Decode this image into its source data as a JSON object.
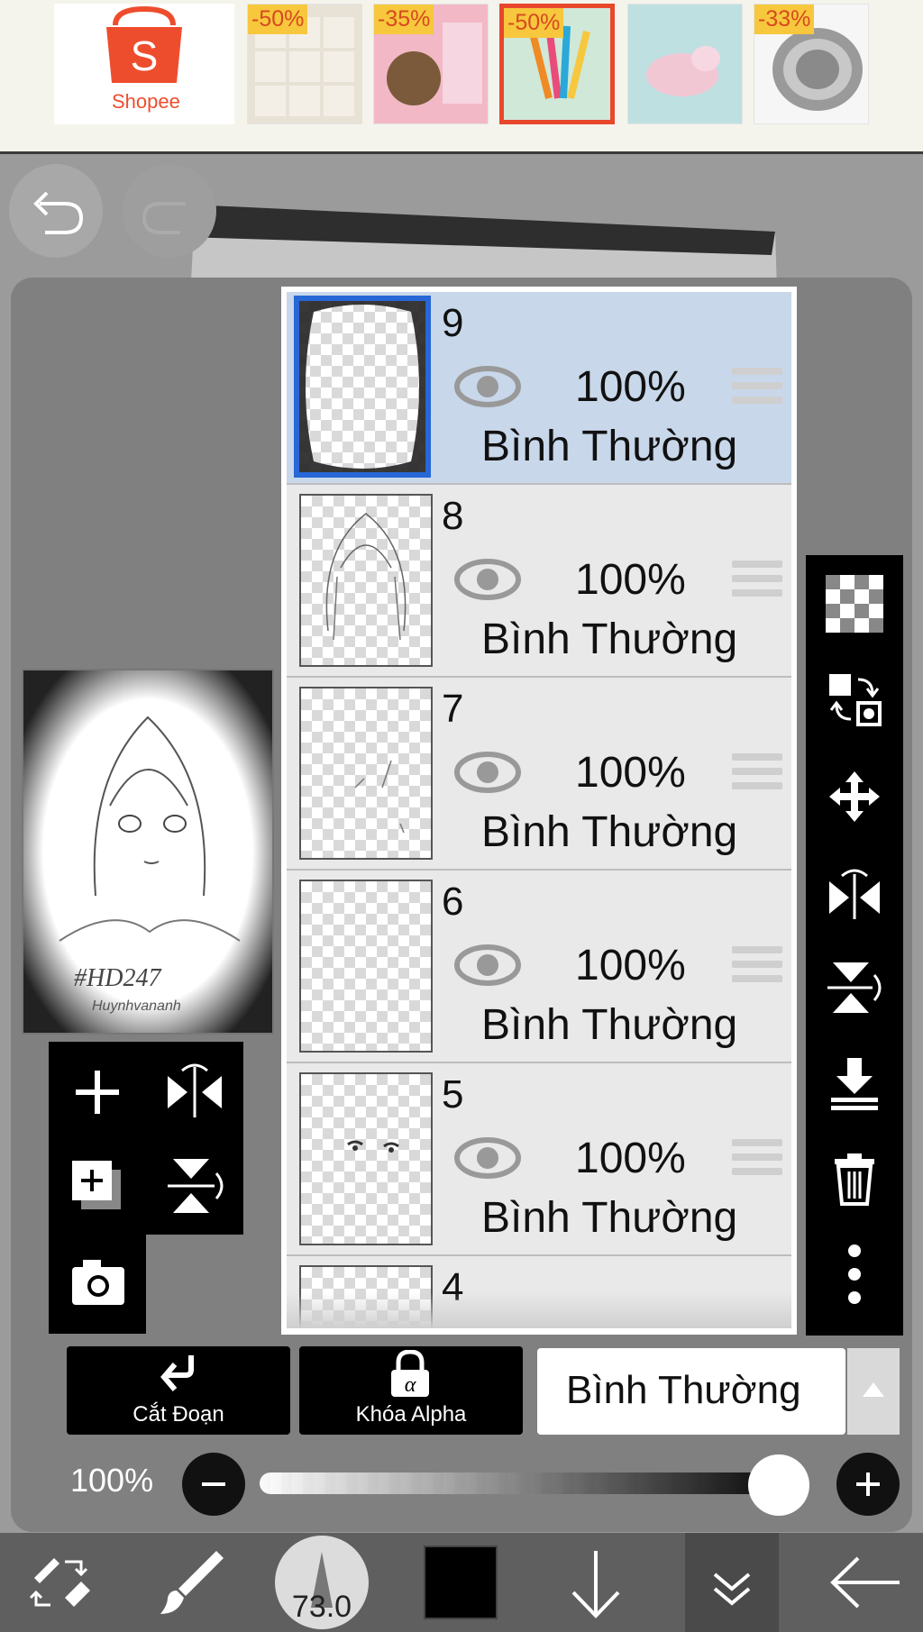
{
  "ad_banner": {
    "brand": "Shopee",
    "products": [
      {
        "discount": "-50%"
      },
      {
        "discount": "-35%"
      },
      {
        "discount": "-50%"
      },
      {
        "discount": ""
      },
      {
        "discount": "-33%"
      }
    ]
  },
  "layers": [
    {
      "number": "9",
      "opacity": "100%",
      "blend_mode": "Bình Thường",
      "selected": true
    },
    {
      "number": "8",
      "opacity": "100%",
      "blend_mode": "Bình Thường",
      "selected": false
    },
    {
      "number": "7",
      "opacity": "100%",
      "blend_mode": "Bình Thường",
      "selected": false
    },
    {
      "number": "6",
      "opacity": "100%",
      "blend_mode": "Bình Thường",
      "selected": false
    },
    {
      "number": "5",
      "opacity": "100%",
      "blend_mode": "Bình Thường",
      "selected": false
    },
    {
      "number": "4",
      "opacity": "",
      "blend_mode": "",
      "selected": false
    }
  ],
  "controls": {
    "clipping_label": "Cắt Đoạn",
    "alpha_lock_label": "Khóa Alpha",
    "blend_mode_value": "Bình Thường",
    "layer_opacity_label": "100%",
    "layer_opacity_value": 1.0
  },
  "preview": {
    "caption": "#HD247",
    "signature": "Huynhvananh"
  },
  "toolbar": {
    "brush_size": "73.0",
    "current_color": "#000000"
  },
  "colors": {
    "selected_layer_bg": "#c8d7ea",
    "selected_layer_border": "#2767d6",
    "ad_highlight": "#e8472c",
    "discount_bg": "#f7c73d",
    "shopee_orange": "#ee4d2d"
  }
}
